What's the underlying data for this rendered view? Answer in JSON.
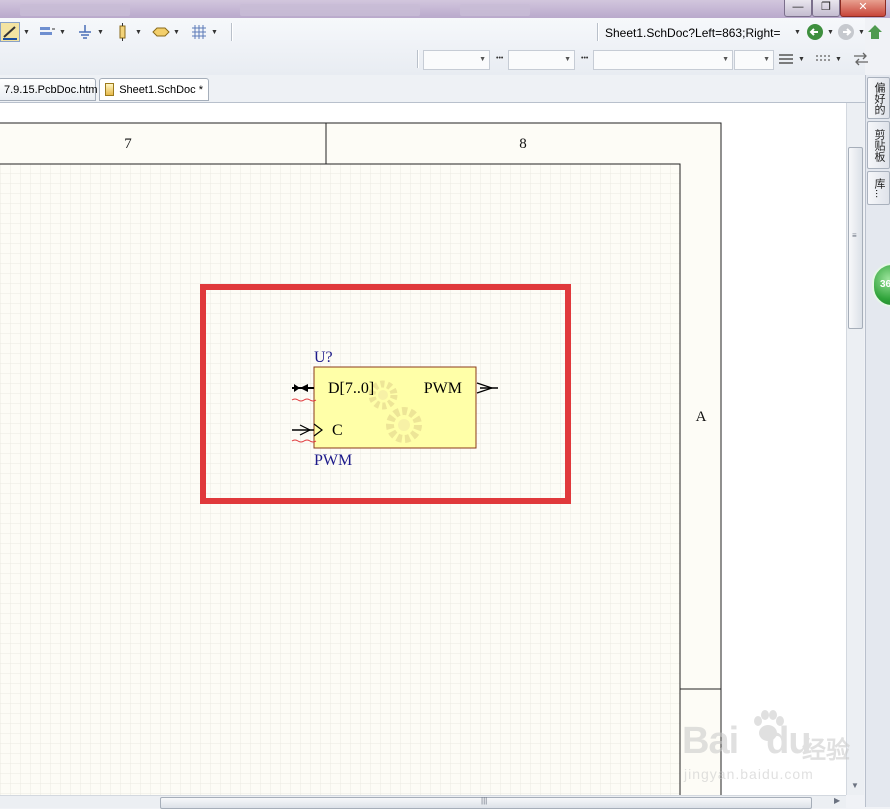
{
  "toolbar": {
    "address": "Sheet1.SchDoc?Left=863;Right="
  },
  "tabs": [
    {
      "label": "7.9.15.PcbDoc.htm",
      "active": false
    },
    {
      "label": "Sheet1.SchDoc *",
      "active": true
    }
  ],
  "right_panel": {
    "tabs": [
      "偏好的",
      "剪贴板",
      "库..."
    ]
  },
  "green_badge": "36",
  "sheet": {
    "zone_columns": [
      "7",
      "8"
    ],
    "zone_rows": [
      "A"
    ],
    "component": {
      "designator": "U?",
      "comment": "PWM",
      "pins": {
        "input_bus": "D[7..0]",
        "clock": "C",
        "output": "PWM"
      }
    }
  },
  "watermark": {
    "brand": "Bai",
    "brand_suffix": "du",
    "chinese": "经验",
    "url": "jingyan.baidu.com"
  },
  "colors": {
    "component_fill": "#ffffa8",
    "component_border": "#8a3a1a",
    "label_blue": "#1d1a8a",
    "highlight_red": "#e0393c",
    "sheet_bg": "#fdfcf6",
    "grid": "#e9e8e0"
  }
}
